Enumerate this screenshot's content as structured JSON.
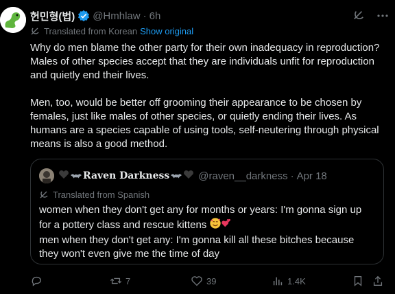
{
  "tweet": {
    "author_name": "헌민형(법)",
    "handle": "@Hmhlaw",
    "separator": "·",
    "time": "6h",
    "translated_label": "Translated from Korean",
    "show_original": "Show original",
    "paragraphs": [
      "Why do men blame the other party for their own inadequacy in reproduction? Males of other species accept that they are individuals unfit for reproduction and quietly end their lives.",
      "Men, too, would be better off grooming their appearance to be chosen by females, just like males of other species, or quietly ending their lives. As humans are a species capable of using tools, self-neutering through physical means is also a good method."
    ]
  },
  "quote": {
    "author_name": "Raven Darkness",
    "handle": "@raven__darkness",
    "separator": "·",
    "time": "Apr 18",
    "translated_label": "Translated from Spanish",
    "line1": "women when they don't get any for months or years: I'm gonna sign up for a pottery class and rescue kittens",
    "line2": "men when they don't get any: I'm gonna kill all these bitches because they won't even give me the time of day"
  },
  "actions": {
    "retweets": "7",
    "likes": "39",
    "views": "1.4K"
  },
  "colors": {
    "background": "#000000",
    "text": "#e7e9ea",
    "muted": "#71767b",
    "accent": "#1d9bf0",
    "border": "#2f3336"
  },
  "icons": [
    "verified-badge-icon",
    "grok-icon",
    "more-icon",
    "translate-icon",
    "reply-icon",
    "retweet-icon",
    "like-icon",
    "views-icon",
    "bookmark-icon",
    "share-icon"
  ]
}
